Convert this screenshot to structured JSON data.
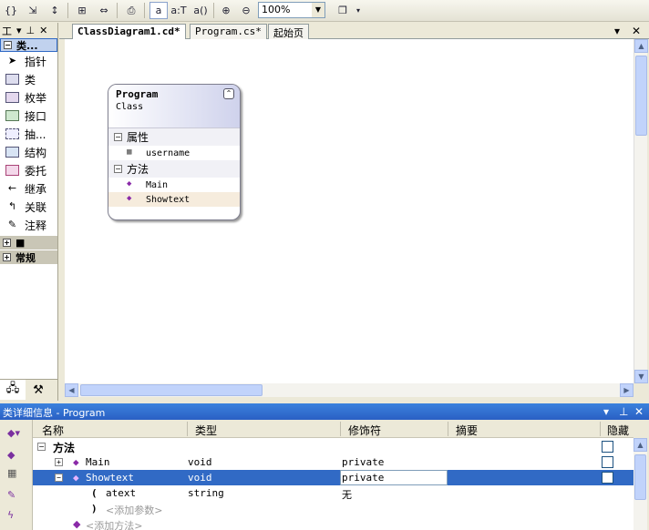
{
  "toolbar": {
    "zoom_value": "100%",
    "members_format_buttons": [
      "a",
      "a:T",
      "a()"
    ]
  },
  "toolbox": {
    "header": "工",
    "category_class": "类...",
    "items": [
      {
        "label": "指针",
        "icon": "pointer-icon"
      },
      {
        "label": "类",
        "icon": "class-icon"
      },
      {
        "label": "枚举",
        "icon": "enum-icon"
      },
      {
        "label": "接口",
        "icon": "interface-icon"
      },
      {
        "label": "抽...",
        "icon": "abstract-class-icon"
      },
      {
        "label": "结构",
        "icon": "struct-icon"
      },
      {
        "label": "委托",
        "icon": "delegate-icon"
      },
      {
        "label": "继承",
        "icon": "inheritance-icon"
      },
      {
        "label": "关联",
        "icon": "association-icon"
      },
      {
        "label": "注释",
        "icon": "comment-icon"
      }
    ],
    "category_empty": "■",
    "category_general": "常规"
  },
  "tabs": [
    {
      "label": "ClassDiagram1.cd*",
      "active": true
    },
    {
      "label": "Program.cs*",
      "active": false
    },
    {
      "label": "起始页",
      "active": false
    }
  ],
  "class_shape": {
    "name": "Program",
    "kind": "Class",
    "properties_label": "属性",
    "properties": [
      "username"
    ],
    "methods_label": "方法",
    "methods": [
      "Main",
      "Showtext"
    ]
  },
  "details": {
    "title": "类详细信息 - Program",
    "columns": [
      "名称",
      "类型",
      "修饰符",
      "摘要",
      "隐藏"
    ],
    "group_label": "方法",
    "rows": [
      {
        "name": "Main",
        "type": "void",
        "modifier": "private"
      },
      {
        "name": "Showtext",
        "type": "void",
        "modifier": "private",
        "selected": true
      },
      {
        "name": "atext",
        "type": "string",
        "modifier": "无",
        "param_prefix": "("
      }
    ],
    "close_paren": ")",
    "add_param": "<添加参数>",
    "add_method": "<添加方法>"
  },
  "colors": {
    "panel_title": "#2a5fc4",
    "selection": "#316ac5",
    "member_icon": "#8a2aa8"
  }
}
